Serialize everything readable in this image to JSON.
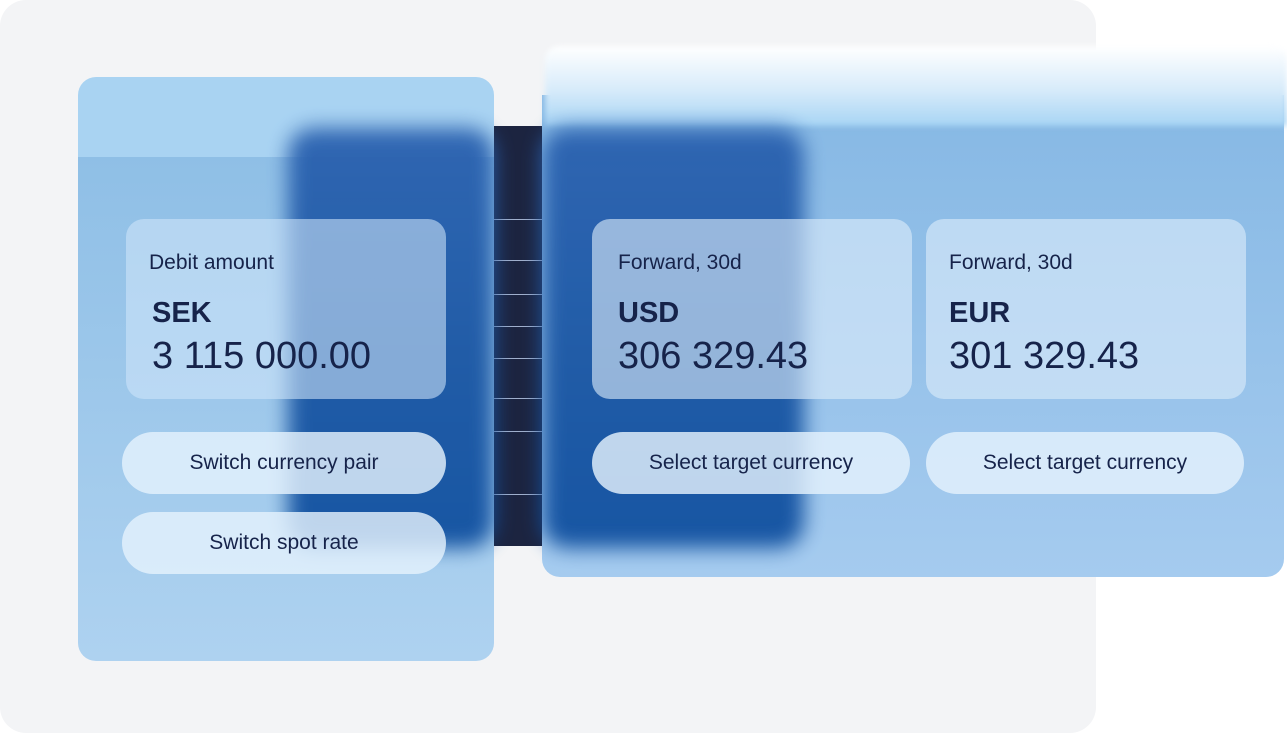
{
  "left_card": {
    "caption": "Debit amount",
    "currency": "SEK",
    "amount": "3 115 000.00"
  },
  "left_actions": {
    "switch_pair": "Switch currency pair",
    "switch_spot": "Switch spot rate"
  },
  "right_cards": [
    {
      "caption": "Forward, 30d",
      "currency": "USD",
      "amount": "306 329.43",
      "action": "Select target currency"
    },
    {
      "caption": "Forward, 30d",
      "currency": "EUR",
      "amount": "301 329.43",
      "action": "Select target currency"
    }
  ],
  "colors": {
    "text": "#16234a",
    "panel_blue": "#8fbfe6",
    "glow_blue": "#1b57a4",
    "connector": "#1c2440"
  }
}
